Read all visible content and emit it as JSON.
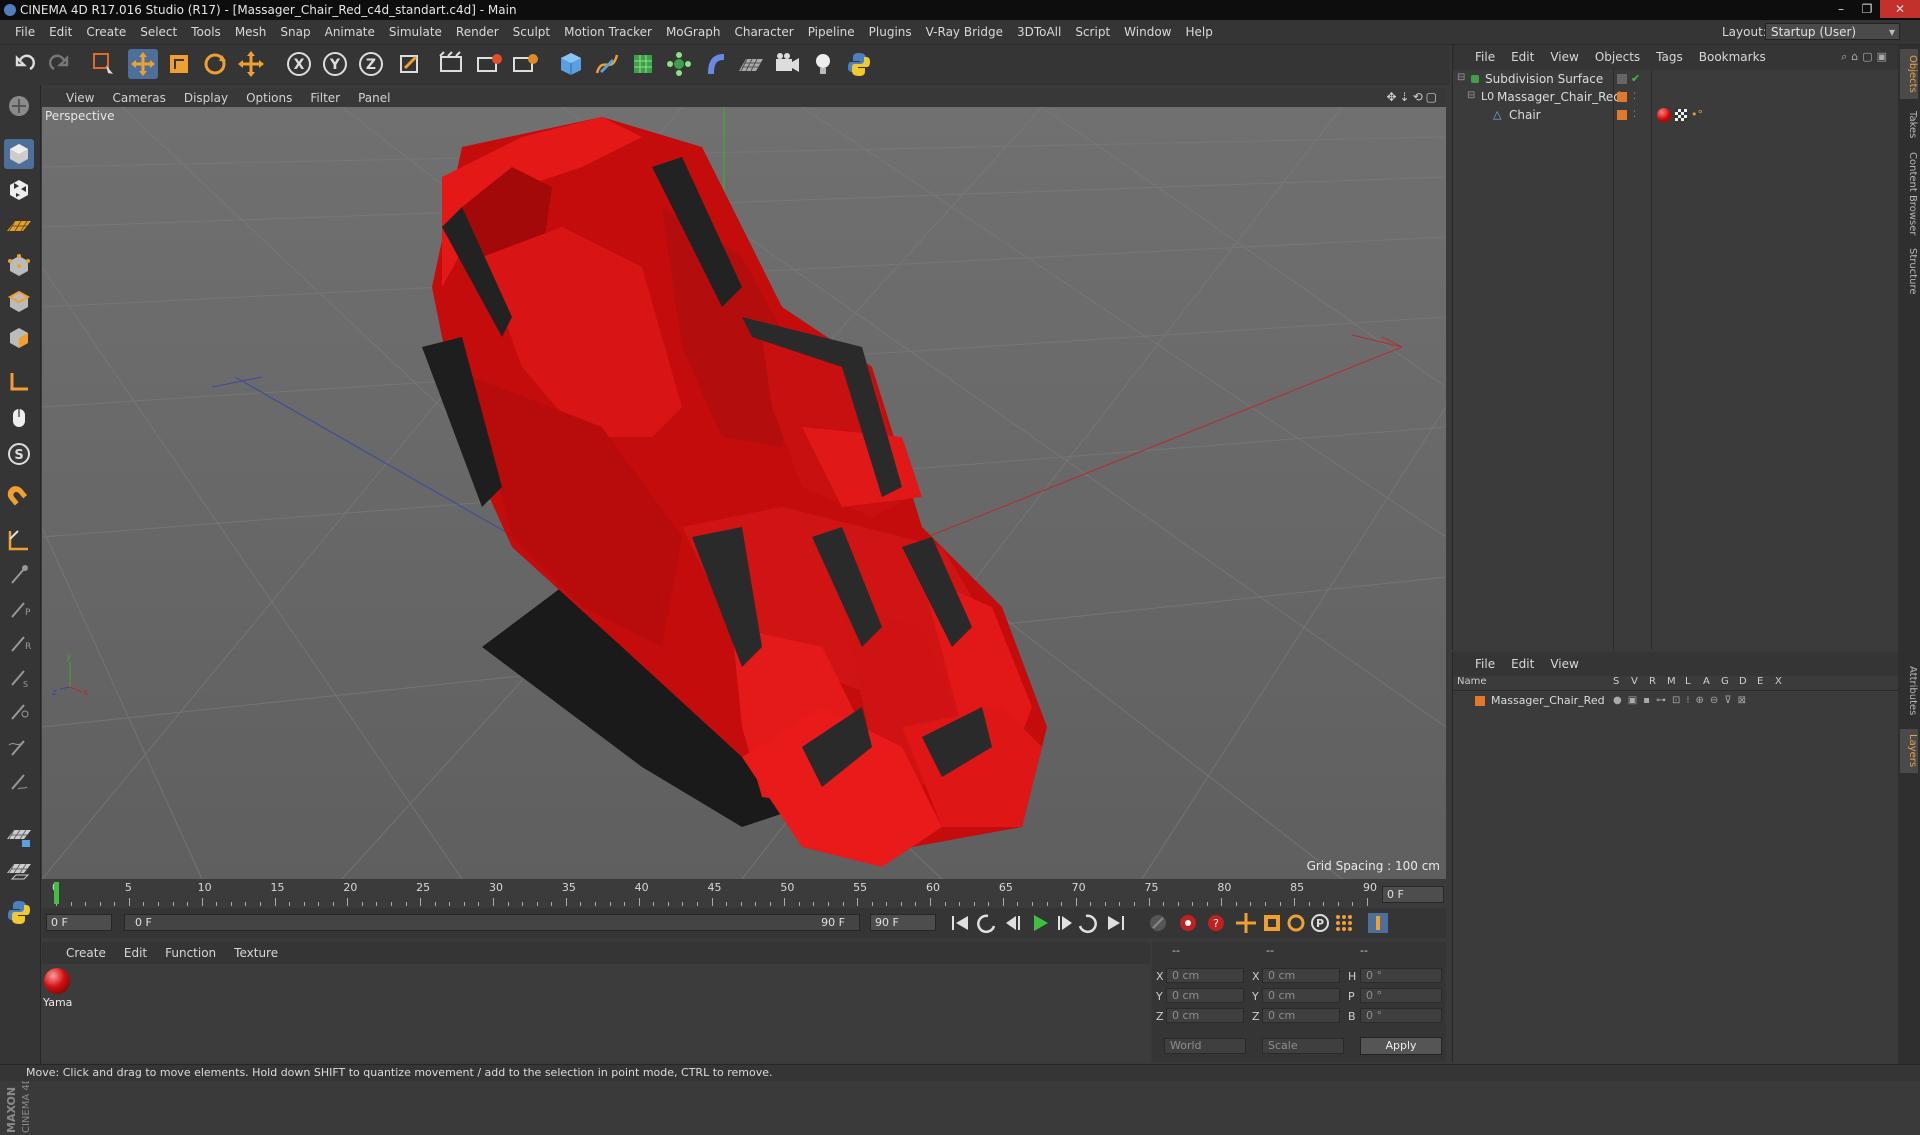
{
  "window": {
    "title": "CINEMA 4D R17.016 Studio (R17) - [Massager_Chair_Red_c4d_standart.c4d] - Main",
    "buttons": [
      "–",
      "❐",
      "✕"
    ]
  },
  "menubar": {
    "items": [
      "File",
      "Edit",
      "Create",
      "Select",
      "Tools",
      "Mesh",
      "Snap",
      "Animate",
      "Simulate",
      "Render",
      "Sculpt",
      "Motion Tracker",
      "MoGraph",
      "Character",
      "Pipeline",
      "Plugins",
      "V-Ray Bridge",
      "3DToAll",
      "Script",
      "Window",
      "Help"
    ],
    "layout_label": "Layout:",
    "layout_value": "Startup (User)"
  },
  "viewport": {
    "menu": [
      "View",
      "Cameras",
      "Display",
      "Options",
      "Filter",
      "Panel"
    ],
    "label": "Perspective",
    "grid_spacing": "Grid Spacing : 100 cm"
  },
  "timeline": {
    "ticks": [
      "0",
      "5",
      "10",
      "15",
      "20",
      "25",
      "30",
      "35",
      "40",
      "45",
      "50",
      "55",
      "60",
      "65",
      "70",
      "75",
      "80",
      "85",
      "90"
    ],
    "current_frame": "0 F",
    "start_field": "0 F",
    "range_start": "0 F",
    "range_end": "90 F",
    "end_field": "90 F"
  },
  "material": {
    "menu": [
      "Create",
      "Edit",
      "Function",
      "Texture"
    ],
    "items": [
      {
        "name": "Yama"
      }
    ]
  },
  "coords": {
    "headers": [
      "--",
      "--",
      "--"
    ],
    "labels_pos": [
      "X",
      "Y",
      "Z"
    ],
    "labels_size": [
      "X",
      "Y",
      "Z"
    ],
    "labels_rot": [
      "H",
      "P",
      "B"
    ],
    "pos": [
      "0 cm",
      "0 cm",
      "0 cm"
    ],
    "size": [
      "0 cm",
      "0 cm",
      "0 cm"
    ],
    "rot": [
      "0 °",
      "0 °",
      "0 °"
    ],
    "mode": "World",
    "scale": "Scale",
    "apply": "Apply"
  },
  "status": "Move: Click and drag to move elements. Hold down SHIFT to quantize movement / add to the selection in point mode, CTRL to remove.",
  "object_manager": {
    "menu": [
      "File",
      "Edit",
      "View",
      "Objects",
      "Tags",
      "Bookmarks"
    ],
    "objects": [
      {
        "name": "Subdivision Surface"
      },
      {
        "name": "Massager_Chair_Red"
      },
      {
        "name": "Chair"
      }
    ]
  },
  "layer_manager": {
    "menu": [
      "File",
      "Edit",
      "View"
    ],
    "columns": [
      "Name",
      "S",
      "V",
      "R",
      "M",
      "L",
      "A",
      "G",
      "D",
      "E",
      "X"
    ],
    "layers": [
      {
        "name": "Massager_Chair_Red"
      }
    ]
  },
  "right_tabs": [
    "Objects",
    "Takes",
    "Content Browser",
    "Structure",
    "Attributes",
    "Layers"
  ],
  "colors": {
    "accent": "#4d6f99",
    "chair_red": "#d01010",
    "layer_orange": "#e07a2a"
  }
}
